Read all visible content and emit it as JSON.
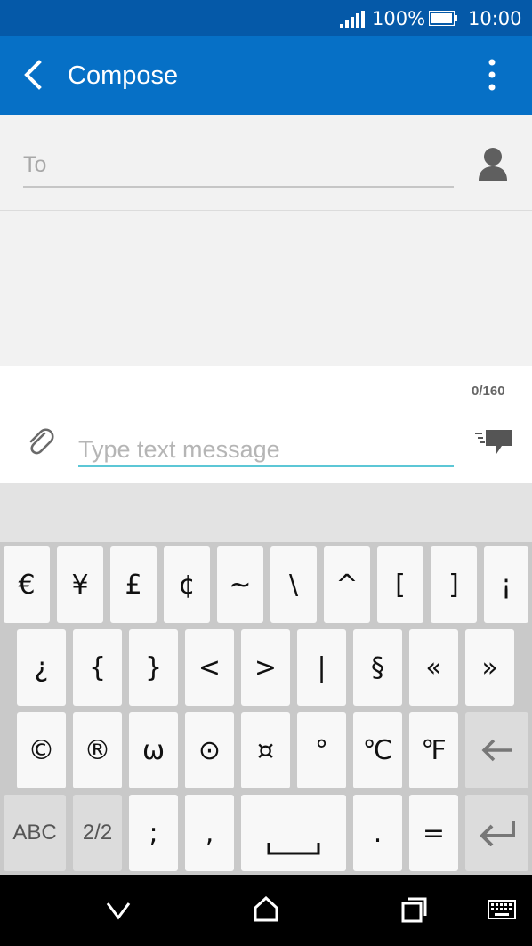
{
  "status_bar": {
    "battery_percent": "100%",
    "time": "10:00",
    "icons": [
      "signal-icon",
      "battery-icon"
    ]
  },
  "app_bar": {
    "title": "Compose",
    "icons": [
      "back-arrow-icon",
      "overflow-menu-icon"
    ]
  },
  "compose": {
    "to_placeholder": "To",
    "contact_icon": "person-icon"
  },
  "message": {
    "char_count": "0/160",
    "placeholder": "Type text message",
    "icons": [
      "paperclip-icon",
      "send-icon"
    ]
  },
  "keyboard": {
    "row1": [
      "€",
      "¥",
      "£",
      "¢",
      "~",
      "\\",
      "^",
      "[",
      "]",
      "¡"
    ],
    "row2": [
      "¿",
      "{",
      "}",
      "<",
      ">",
      "|",
      "§",
      "«",
      "»"
    ],
    "row3": [
      "©",
      "®",
      "ω",
      "⊙",
      "¤",
      "°",
      "℃",
      "℉"
    ],
    "row4": {
      "abc": "ABC",
      "page": "2/2",
      "semicolon": ";",
      "comma": ",",
      "period": ".",
      "equals": "="
    },
    "icons": [
      "backspace-icon",
      "space-icon",
      "enter-icon"
    ]
  },
  "nav_bar": {
    "icons": [
      "back-chevron-icon",
      "home-icon",
      "recents-icon",
      "keyboard-icon"
    ]
  },
  "colors": {
    "status_bar": "#0559a8",
    "app_bar": "#0670c6",
    "accent": "#5cc7d6"
  }
}
